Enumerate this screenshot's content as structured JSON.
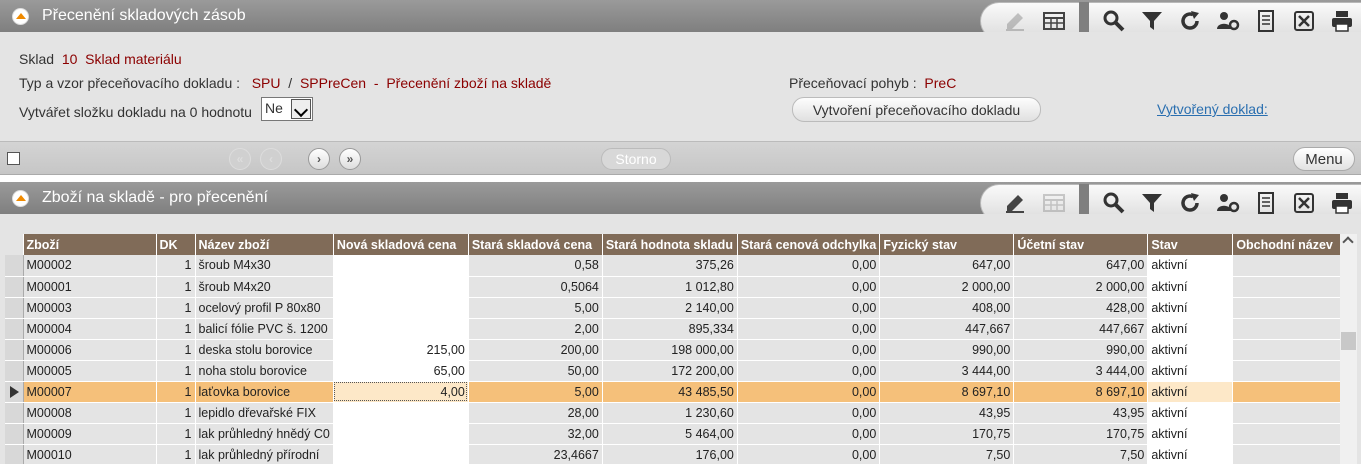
{
  "header1": {
    "title": "Přecenění skladových zásob"
  },
  "header2": {
    "title": "Zboží na skladě - pro přecenění"
  },
  "form": {
    "sklad_label": "Sklad",
    "sklad_number": "10",
    "sklad_name": "Sklad materiálu",
    "typ_label": "Typ a vzor přeceňovacího dokladu :",
    "typ_code": "SPU",
    "typ_sep": "/",
    "typ_vzor": "SPPreCen",
    "typ_dash": "-",
    "typ_name": "Přecenění zboží na skladě",
    "zero_label": "Vytvářet složku dokladu na 0 hodnotu",
    "zero_value": "Ne",
    "pohyb_label": "Přeceňovací pohyb :",
    "pohyb_value": "PreC",
    "create_button": "Vytvoření přeceňovacího dokladu",
    "created_link": "Vytvořený doklad:"
  },
  "navbar": {
    "first": "«",
    "prev": "‹",
    "next": "›",
    "last": "»",
    "storno": "Storno",
    "menu": "Menu"
  },
  "table": {
    "columns": [
      "Zboží",
      "DK",
      "Název zboží",
      "Nová skladová cena",
      "Stará skladová cena",
      "Stará hodnota skladu",
      "Stará cenová odchylka",
      "Fyzický stav",
      "Účetní stav",
      "Stav",
      "Obchodní název"
    ],
    "rows": [
      {
        "zbozi": "M00002",
        "dk": "1",
        "nazev": "šroub M4x30",
        "nova": "",
        "stara_cena": "0,58",
        "stara_hodnota": "375,26",
        "odchylka": "0,00",
        "fyz": "647,00",
        "uct": "647,00",
        "stav": "aktivní",
        "obch": ""
      },
      {
        "zbozi": "M00001",
        "dk": "1",
        "nazev": "šroub M4x20",
        "nova": "",
        "stara_cena": "0,5064",
        "stara_hodnota": "1 012,80",
        "odchylka": "0,00",
        "fyz": "2 000,00",
        "uct": "2 000,00",
        "stav": "aktivní",
        "obch": ""
      },
      {
        "zbozi": "M00003",
        "dk": "1",
        "nazev": "ocelový profil P 80x80",
        "nova": "",
        "stara_cena": "5,00",
        "stara_hodnota": "2 140,00",
        "odchylka": "0,00",
        "fyz": "408,00",
        "uct": "428,00",
        "stav": "aktivní",
        "obch": ""
      },
      {
        "zbozi": "M00004",
        "dk": "1",
        "nazev": "balicí fólie PVC š. 1200",
        "nova": "",
        "stara_cena": "2,00",
        "stara_hodnota": "895,334",
        "odchylka": "0,00",
        "fyz": "447,667",
        "uct": "447,667",
        "stav": "aktivní",
        "obch": ""
      },
      {
        "zbozi": "M00006",
        "dk": "1",
        "nazev": "deska stolu borovice",
        "nova": "215,00",
        "stara_cena": "200,00",
        "stara_hodnota": "198 000,00",
        "odchylka": "0,00",
        "fyz": "990,00",
        "uct": "990,00",
        "stav": "aktivní",
        "obch": ""
      },
      {
        "zbozi": "M00005",
        "dk": "1",
        "nazev": "noha stolu borovice",
        "nova": "65,00",
        "stara_cena": "50,00",
        "stara_hodnota": "172 200,00",
        "odchylka": "0,00",
        "fyz": "3 444,00",
        "uct": "3 444,00",
        "stav": "aktivní",
        "obch": ""
      },
      {
        "zbozi": "M00007",
        "dk": "1",
        "nazev": "laťovka borovice",
        "nova": "4,00",
        "stara_cena": "5,00",
        "stara_hodnota": "43 485,50",
        "odchylka": "0,00",
        "fyz": "8 697,10",
        "uct": "8 697,10",
        "stav": "aktivní",
        "obch": ""
      },
      {
        "zbozi": "M00008",
        "dk": "1",
        "nazev": "lepidlo dřevařské FIX",
        "nova": "",
        "stara_cena": "28,00",
        "stara_hodnota": "1 230,60",
        "odchylka": "0,00",
        "fyz": "43,95",
        "uct": "43,95",
        "stav": "aktivní",
        "obch": ""
      },
      {
        "zbozi": "M00009",
        "dk": "1",
        "nazev": "lak průhledný hnědý C0",
        "nova": "",
        "stara_cena": "32,00",
        "stara_hodnota": "5 464,00",
        "odchylka": "0,00",
        "fyz": "170,75",
        "uct": "170,75",
        "stav": "aktivní",
        "obch": ""
      },
      {
        "zbozi": "M00010",
        "dk": "1",
        "nazev": "lak průhledný přírodní",
        "nova": "",
        "stara_cena": "23,4667",
        "stara_hodnota": "176,00",
        "odchylka": "0,00",
        "fyz": "7,50",
        "uct": "7,50",
        "stav": "aktivní",
        "obch": ""
      }
    ],
    "selected_row": 6
  },
  "colors": {
    "header_bg": "#806b58",
    "selected_row": "#f5c07a",
    "value_text": "#8b0000",
    "link": "#2a6fb0",
    "collapse_arrow": "#f08a00"
  }
}
